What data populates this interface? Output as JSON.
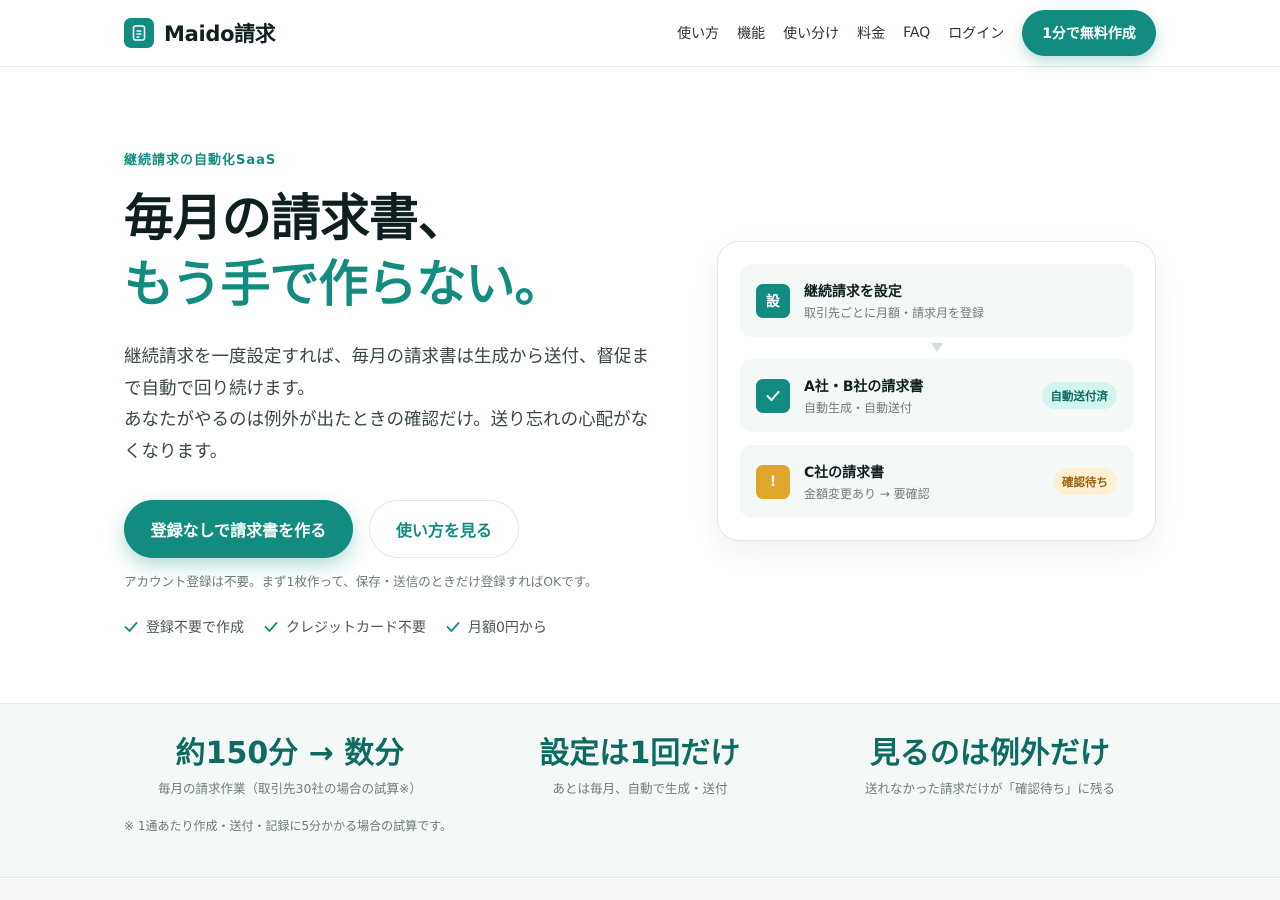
{
  "header": {
    "brand": "Maido請求",
    "nav": [
      "使い方",
      "機能",
      "使い分け",
      "料金",
      "FAQ",
      "ログイン"
    ],
    "cta": "1分で無料作成"
  },
  "hero": {
    "eyebrow": "継続請求の自動化SaaS",
    "title_line1": "毎月の請求書、",
    "title_line2": "もう手で作らない。",
    "lead_p1": "継続請求を一度設定すれば、毎月の請求書は生成から送付、督促まで自動で回り続けます。",
    "lead_p2": "あなたがやるのは例外が出たときの確認だけ。送り忘れの心配がなくなります。",
    "primary_cta": "登録なしで請求書を作る",
    "secondary_cta": "使い方を見る",
    "note": "アカウント登録は不要。まず1枚作って、保存・送信のときだけ登録すればOKです。",
    "checks": [
      "登録不要で作成",
      "クレジットカード不要",
      "月額0円から"
    ]
  },
  "flow_card": {
    "rows": [
      {
        "icon_text": "設",
        "title": "継続請求を設定",
        "sub": "取引先ごとに月額・請求月を登録",
        "badge": ""
      },
      {
        "icon_text": "",
        "title": "A社・B社の請求書",
        "sub": "自動生成・自動送付",
        "badge": "自動送付済"
      },
      {
        "icon_text": "!",
        "title": "C社の請求書",
        "sub": "金額変更あり → 要確認",
        "badge": "確認待ち"
      }
    ]
  },
  "stats": {
    "items": [
      {
        "value": "約150分 → 数分",
        "desc": "毎月の請求作業（取引先30社の場合の試算※）"
      },
      {
        "value": "設定は1回だけ",
        "desc": "あとは毎月、自動で生成・送付"
      },
      {
        "value": "見るのは例外だけ",
        "desc": "送れなかった請求だけが「確認待ち」に残る"
      }
    ],
    "footnote": "※ 1通あたり作成・送付・記録に5分かかる場合の試算です。"
  },
  "colors": {
    "accent": "#138c80",
    "accent_dark": "#0d6b62",
    "warning": "#e0a62c",
    "success_badge_bg": "#d3f5ef",
    "warning_badge_bg": "#fdf0d3"
  }
}
